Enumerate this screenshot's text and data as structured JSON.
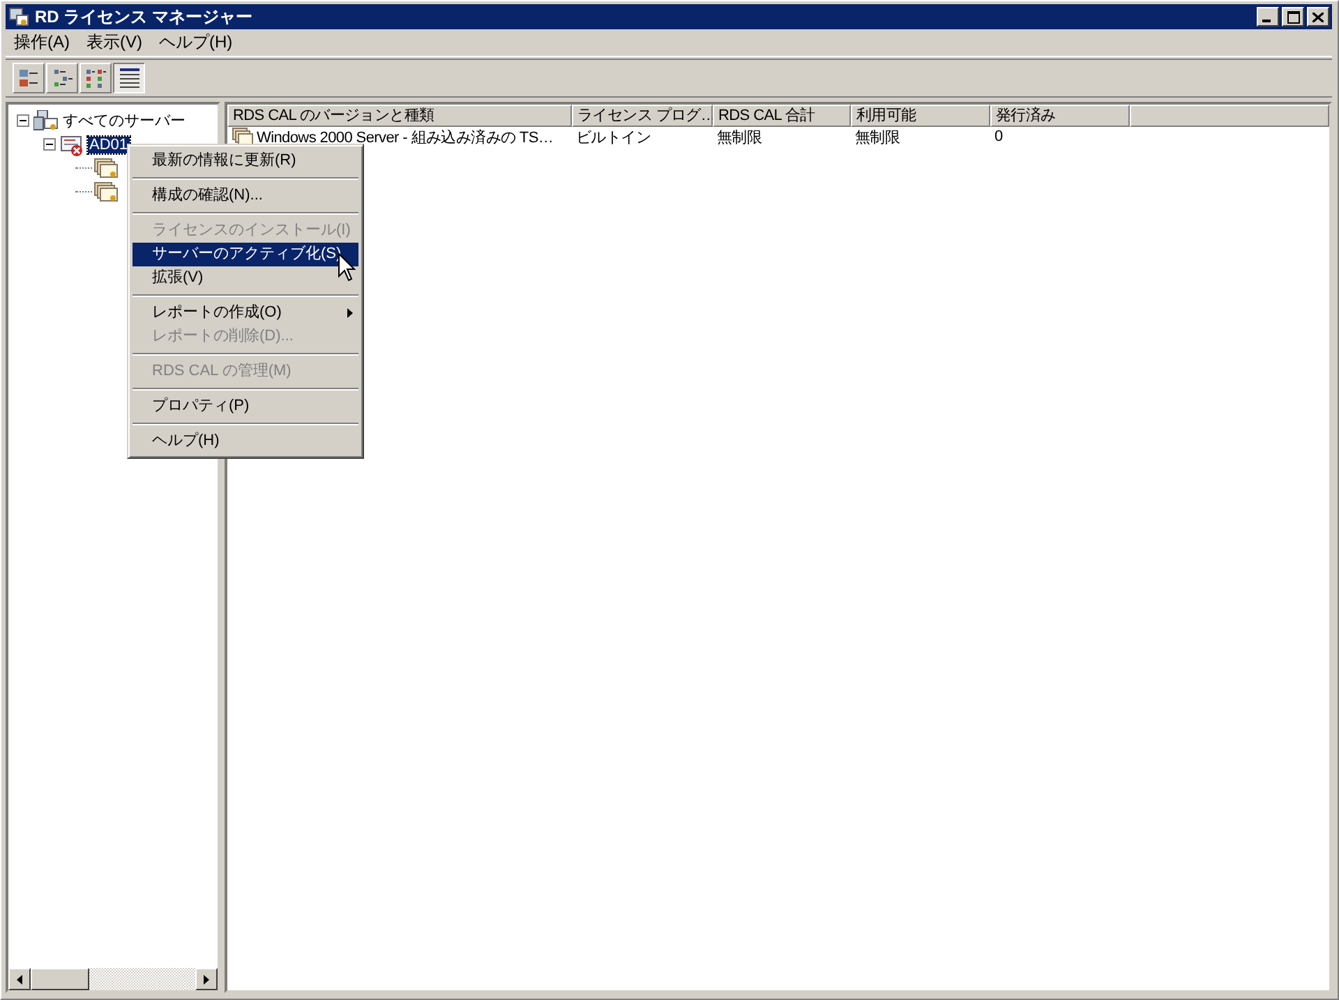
{
  "window": {
    "title": "RD ライセンス マネージャー"
  },
  "menu_bar": [
    "操作(A)",
    "表示(V)",
    "ヘルプ(H)"
  ],
  "toolbar": [
    {
      "kind": "large-icons",
      "selected": false
    },
    {
      "kind": "small-icons",
      "selected": false
    },
    {
      "kind": "list",
      "selected": false
    },
    {
      "kind": "details",
      "selected": true
    }
  ],
  "tree": {
    "label": "すべてのサーバー",
    "expanded": true,
    "selected": false,
    "children": [
      {
        "label": "AD01",
        "expanded": true,
        "selected": true,
        "error": true,
        "children": [
          {
            "kind": "license-pack"
          },
          {
            "kind": "license-pack"
          }
        ]
      }
    ]
  },
  "table": {
    "columns": [
      "RDS CAL のバージョンと種類",
      "ライセンス プログ…",
      "RDS CAL 合計",
      "利用可能",
      "発行済み"
    ],
    "rows": [
      [
        "Windows 2000 Server - 組み込み済みの TS…",
        "ビルトイン",
        "無制限",
        "無制限",
        "0"
      ]
    ]
  },
  "context_menu": [
    {
      "kind": "item",
      "label": "最新の情報に更新(R)",
      "disabled": false,
      "selected": false,
      "submenu": false
    },
    {
      "kind": "separator"
    },
    {
      "kind": "item",
      "label": "構成の確認(N)...",
      "disabled": false,
      "selected": false,
      "submenu": false
    },
    {
      "kind": "separator"
    },
    {
      "kind": "item",
      "label": "ライセンスのインストール(I)",
      "disabled": true,
      "selected": false,
      "submenu": false
    },
    {
      "kind": "item",
      "label": "サーバーのアクティブ化(S)",
      "disabled": false,
      "selected": true,
      "submenu": false
    },
    {
      "kind": "item",
      "label": "拡張(V)",
      "disabled": false,
      "selected": false,
      "submenu": false
    },
    {
      "kind": "separator"
    },
    {
      "kind": "item",
      "label": "レポートの作成(O)",
      "disabled": false,
      "selected": false,
      "submenu": true
    },
    {
      "kind": "item",
      "label": "レポートの削除(D)...",
      "disabled": true,
      "selected": false,
      "submenu": false
    },
    {
      "kind": "separator"
    },
    {
      "kind": "item",
      "label": "RDS CAL の管理(M)",
      "disabled": true,
      "selected": false,
      "submenu": false
    },
    {
      "kind": "separator"
    },
    {
      "kind": "item",
      "label": "プロパティ(P)",
      "disabled": false,
      "selected": false,
      "submenu": false
    },
    {
      "kind": "separator"
    },
    {
      "kind": "item",
      "label": "ヘルプ(H)",
      "disabled": false,
      "selected": false,
      "submenu": false
    }
  ]
}
